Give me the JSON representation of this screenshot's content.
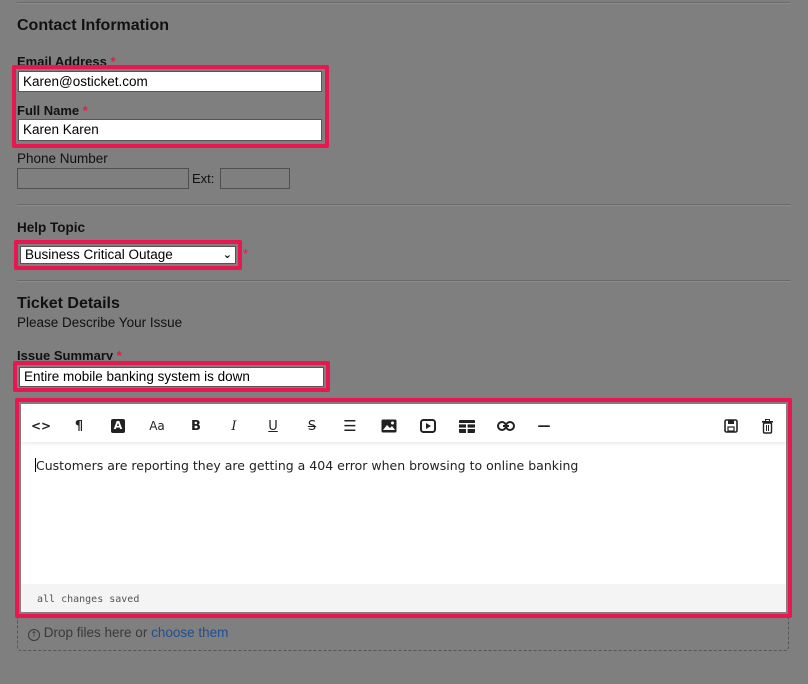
{
  "contact": {
    "heading": "Contact Information",
    "email_label": "Email Address",
    "email_value": "Karen@osticket.com",
    "name_label": "Full Name",
    "name_value": "Karen Karen",
    "phone_label": "Phone Number",
    "ext_label": "Ext:",
    "required_mark": "*"
  },
  "help_topic": {
    "label": "Help Topic",
    "selected": "Business Critical Outage",
    "required_mark": "*"
  },
  "ticket": {
    "heading": "Ticket Details",
    "subheading": "Please Describe Your Issue",
    "summary_label": "Issue Summary",
    "summary_value": "Entire mobile banking system is down",
    "required_mark": "*"
  },
  "editor": {
    "body_text": "Customers are reporting they are getting a 404 error when browsing to online banking",
    "status_text": "all changes saved",
    "toolbar": {
      "code": "<>",
      "paragraph": "¶",
      "text_color": "A",
      "font_size": "Aa",
      "bold": "B",
      "italic": "I",
      "underline": "U",
      "strike": "S",
      "list": "☰",
      "image": "image-icon",
      "video": "video-icon",
      "table": "table-icon",
      "link": "link-icon",
      "hr": "—",
      "save": "save-icon",
      "delete": "trash-icon"
    }
  },
  "attachments": {
    "drop_text": "Drop files here or",
    "choose_link": "choose them"
  },
  "colors": {
    "background": "#7f7f7f",
    "highlight": "#e8174f",
    "required": "#e11d48",
    "link": "#1f4f8f"
  }
}
